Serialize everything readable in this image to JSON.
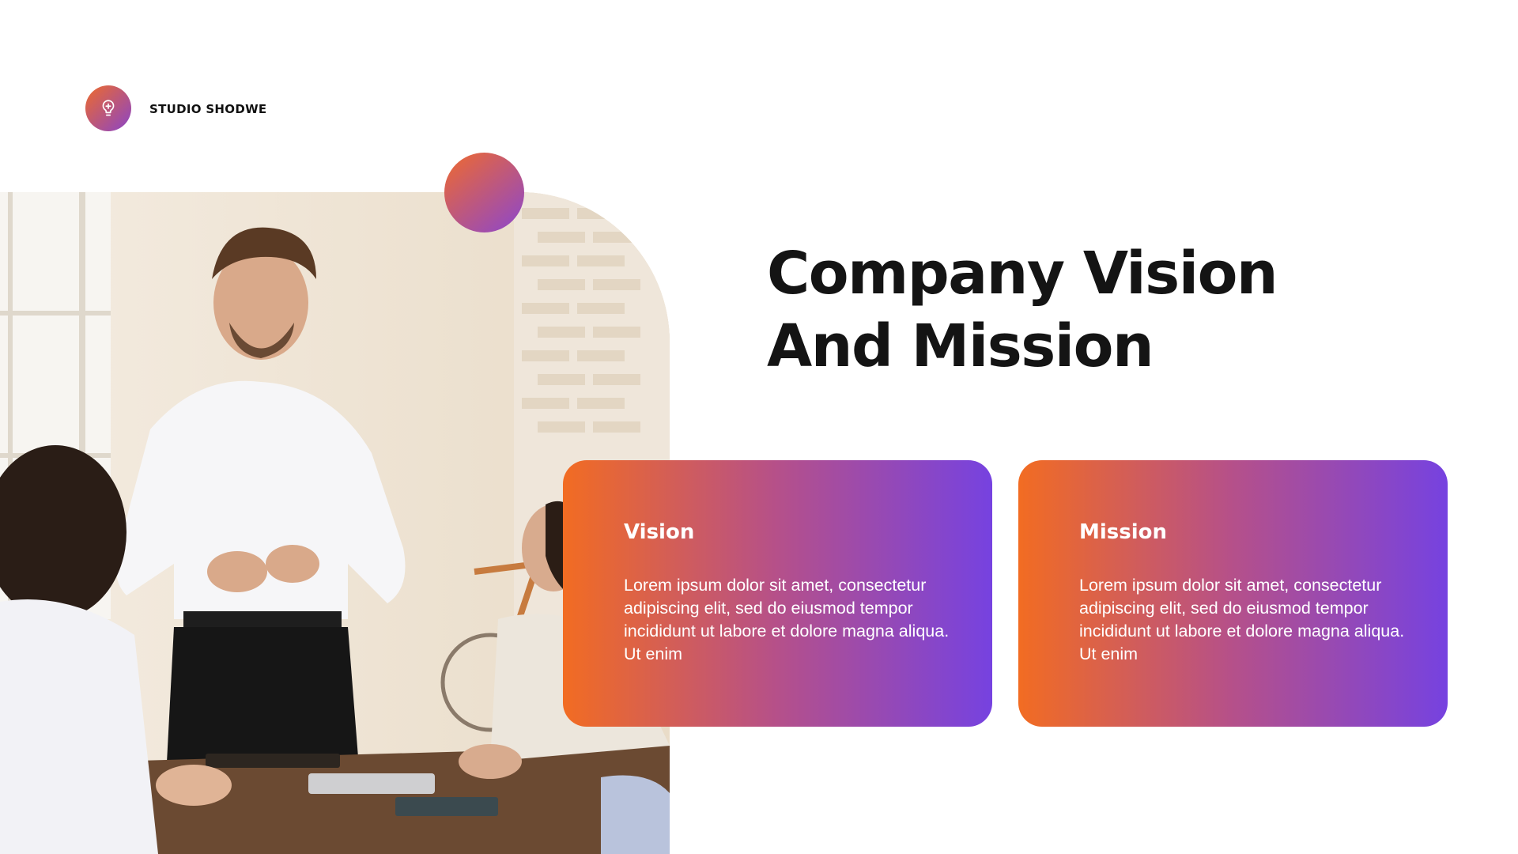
{
  "brand": {
    "name": "STUDIO SHODWE",
    "icon": "lightbulb-icon"
  },
  "heading": {
    "line1": "Company Vision",
    "line2": "And Mission"
  },
  "cards": [
    {
      "title": "Vision",
      "body": "Lorem ipsum dolor sit amet, consectetur adipiscing elit, sed do eiusmod tempor incididunt ut labore et dolore magna aliqua. Ut enim"
    },
    {
      "title": "Mission",
      "body": "Lorem ipsum dolor sit amet, consectetur adipiscing elit, sed do eiusmod tempor incididunt ut labore et dolore magna aliqua. Ut enim"
    }
  ],
  "colors": {
    "gradient_start": "#f26c22",
    "gradient_end": "#7642e0",
    "text_dark": "#141414"
  }
}
